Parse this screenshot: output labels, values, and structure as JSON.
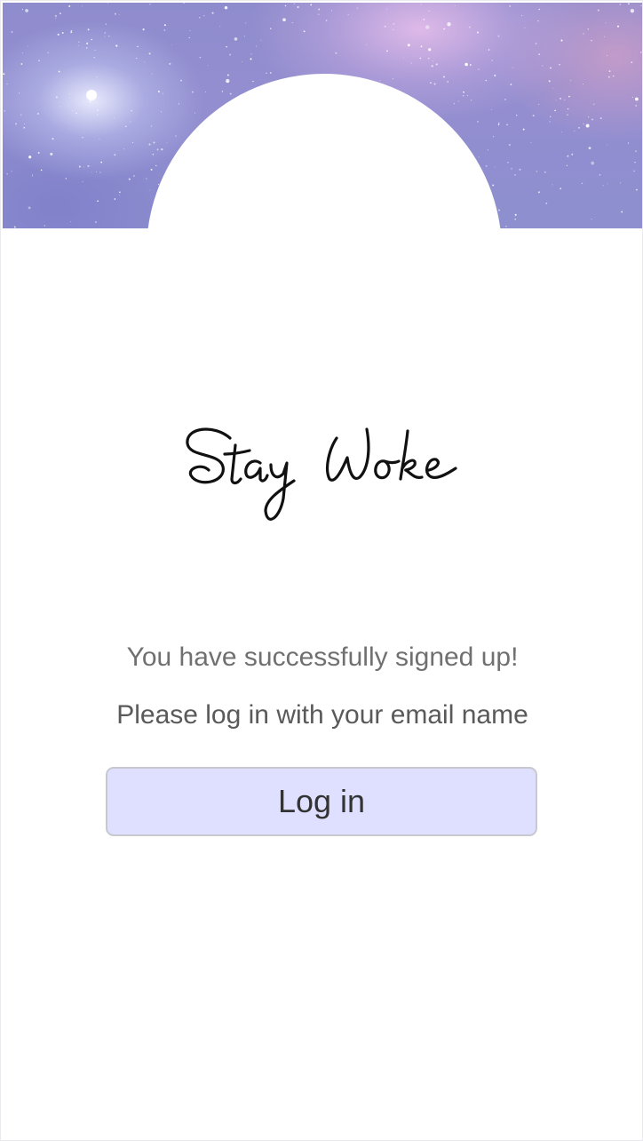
{
  "header": {
    "banner_image": "galaxy-starfield-banner"
  },
  "logo": {
    "text": "Stay Woke",
    "style": "handwritten-script"
  },
  "messages": {
    "success": "You have successfully signed up!",
    "instruction": "Please log in with your email name"
  },
  "actions": {
    "login_label": "Log in"
  },
  "colors": {
    "button_background": "#dfe0ff",
    "button_border": "#c8c8d0",
    "banner_base": "#8f8ccd",
    "text_muted": "#707070"
  }
}
